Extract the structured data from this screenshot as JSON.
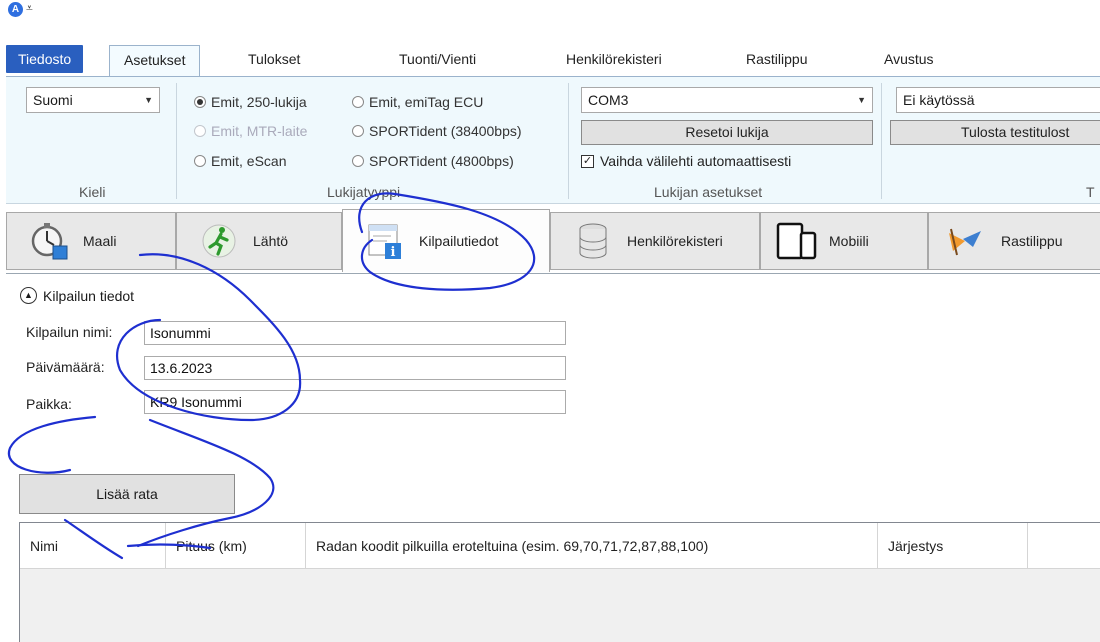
{
  "ribbon_tabs": [
    "Tiedosto",
    "Asetukset",
    "Tulokset",
    "Tuonti/Vienti",
    "Henkilörekisteri",
    "Rastilippu",
    "Avustus"
  ],
  "language": {
    "value": "Suomi",
    "group_label": "Kieli"
  },
  "reader_type": {
    "group_label": "Lukijatyyppi",
    "options": [
      "Emit, 250-lukija",
      "Emit, MTR-laite",
      "Emit, eScan",
      "Emit, emiTag ECU",
      "SPORTident (38400bps)",
      "SPORTident (4800bps)"
    ],
    "selected": "Emit, 250-lukija"
  },
  "reader_settings": {
    "group_label": "Lukijan asetukset",
    "port": "COM3",
    "reset_label": "Resetoi lukija",
    "auto_switch_label": "Vaihda välilehti automaattisesti"
  },
  "print": {
    "value": "Ei käytössä",
    "button_label": "Tulosta testitulost",
    "group_label": "T"
  },
  "module_tabs": [
    "Maali",
    "Lähtö",
    "Kilpailutiedot",
    "Henkilörekisteri",
    "Mobiili",
    "Rastilippu"
  ],
  "active_module": "Kilpailutiedot",
  "competition": {
    "section_title": "Kilpailun tiedot",
    "name_label": "Kilpailun nimi:",
    "name_value": "Isonummi",
    "date_label": "Päivämäärä:",
    "date_value": "13.6.2023",
    "place_label": "Paikka:",
    "place_value": "KR9 Isonummi"
  },
  "add_course_label": "Lisää rata",
  "course_table": {
    "columns": [
      "Nimi",
      "Pituus (km)",
      "Radan koodit pilkuilla eroteltuina (esim. 69,70,71,72,87,88,100)",
      "Järjestys"
    ]
  },
  "colors": {
    "accent": "#2a5fbf",
    "ribbon_bg": "#eff9fd",
    "annotation": "#1e2fd0"
  }
}
